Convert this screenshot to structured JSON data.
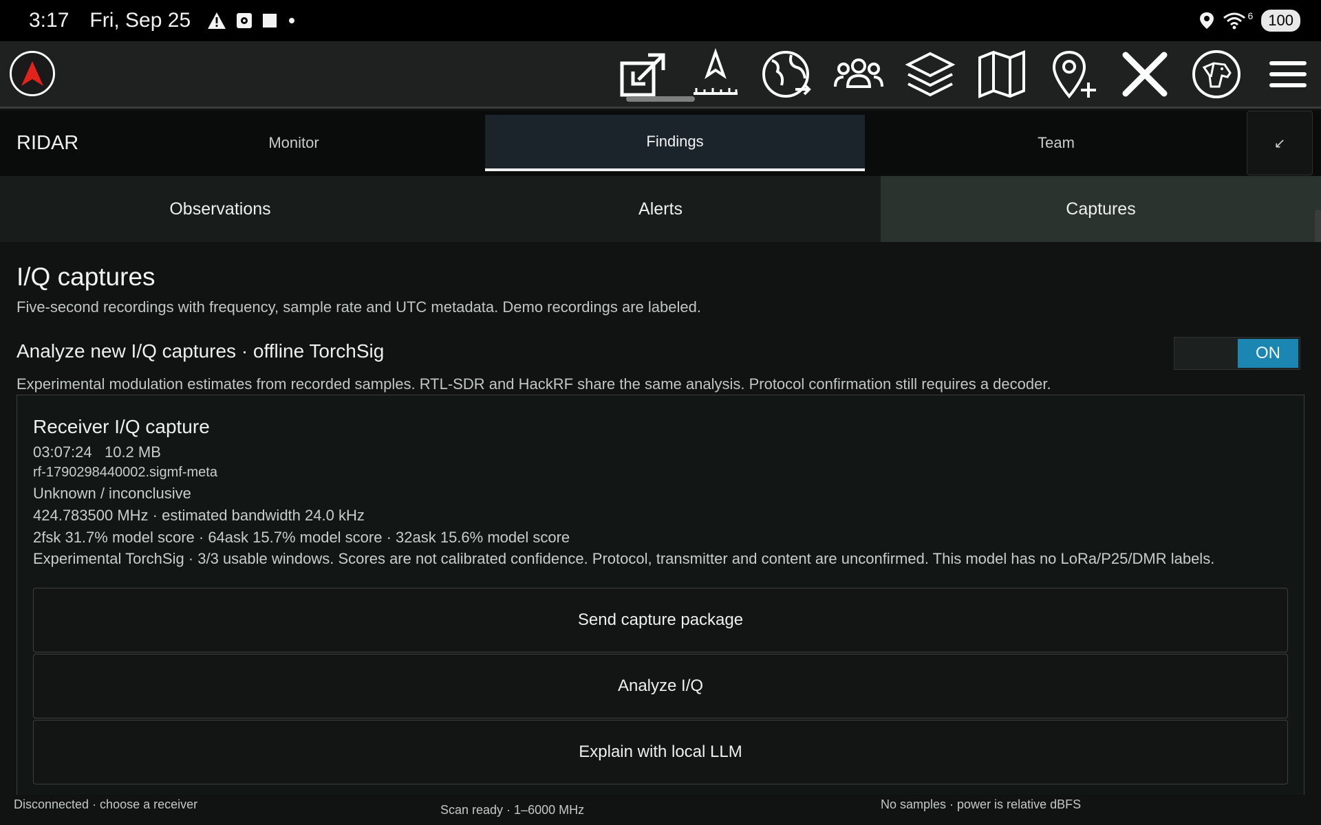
{
  "status_bar": {
    "time": "3:17",
    "date": "Fri, Sep 25",
    "icons": [
      "warning-icon",
      "media-icon",
      "square-icon",
      "dot-icon"
    ],
    "right_icons": [
      "location-icon",
      "wifi-icon"
    ],
    "wifi_label": "6",
    "battery": "100"
  },
  "toolbar": {
    "tools": [
      "external-link-icon",
      "measure-icon",
      "globe-icon",
      "team-icon",
      "layers-icon",
      "map-icon",
      "add-pin-icon",
      "close-icon",
      "dog-icon",
      "menu-icon"
    ]
  },
  "primary_tabs": {
    "brand": "RIDAR",
    "tabs": [
      {
        "label": "Monitor",
        "active": false
      },
      {
        "label": "Findings",
        "active": true
      },
      {
        "label": "Team",
        "active": false
      }
    ],
    "collapse_glyph": "↙"
  },
  "secondary_tabs": {
    "tabs": [
      {
        "label": "Observations",
        "active": false
      },
      {
        "label": "Alerts",
        "active": false
      },
      {
        "label": "Captures",
        "active": true
      }
    ]
  },
  "main": {
    "title": "I/Q captures",
    "subtitle": "Five-second recordings with frequency, sample rate and UTC metadata. Demo recordings are labeled.",
    "analyze": {
      "title": "Analyze new I/Q captures · offline TorchSig",
      "description": "Experimental modulation estimates from recorded samples. RTL-SDR and HackRF share the same analysis. Protocol confirmation still requires a decoder.",
      "toggle_label": "ON",
      "toggle_on": true
    },
    "card": {
      "title": "Receiver I/Q capture",
      "time_size": "03:07:24   10.2 MB",
      "filename": "rf-1790298440002.sigmf-meta",
      "classification": "Unknown / inconclusive",
      "frequency": "424.783500 MHz · estimated bandwidth 24.0 kHz",
      "scores": "2fsk 31.7% model score · 64ask 15.7% model score · 32ask 15.6% model score",
      "note": "Experimental TorchSig · 3/3 usable windows. Scores are not calibrated confidence. Protocol, transmitter and content are unconfirmed. This model has no LoRa/P25/DMR labels.",
      "buttons": {
        "send": "Send capture package",
        "analyze": "Analyze I/Q",
        "explain": "Explain with local LLM"
      }
    }
  },
  "footer": {
    "connection": "Disconnected · choose a receiver",
    "scan": "Scan ready · 1–6000 MHz",
    "samples": "No samples · power is relative dBFS"
  },
  "colors": {
    "accent": "#1c86b3",
    "logo_arrow": "#e0241b",
    "toolbar_bg": "#1f2120",
    "active_tab_bg": "#1b232b",
    "active_subtab_bg": "#2a332d"
  }
}
